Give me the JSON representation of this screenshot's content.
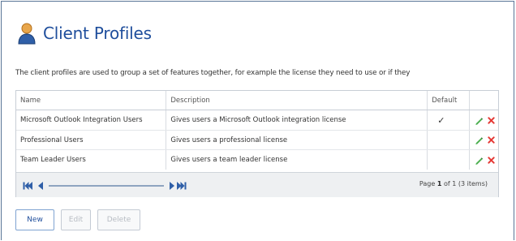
{
  "header": {
    "title": "Client Profiles",
    "icon": "person-icon"
  },
  "description": "The client profiles are used to group a set of features together, for example the license they need to use or if they",
  "grid": {
    "columns": {
      "name": "Name",
      "description": "Description",
      "default": "Default"
    },
    "rows": [
      {
        "name": "Microsoft Outlook Integration Users",
        "description": "Gives users a Microsoft Outlook integration license",
        "default": "✓"
      },
      {
        "name": "Professional Users",
        "description": "Gives users a professional license",
        "default": ""
      },
      {
        "name": "Team Leader Users",
        "description": "Gives users a team leader license",
        "default": ""
      }
    ],
    "row_actions": [
      "edit-icon",
      "delete-icon"
    ],
    "pager": {
      "text_prefix": "Page",
      "page": "1",
      "text_of": "of",
      "total_pages": "1",
      "item_count": "(3 items)"
    }
  },
  "buttons": {
    "new": "New",
    "edit": "Edit",
    "delete": "Delete"
  },
  "colors": {
    "title": "#1f4e9c",
    "frame": "#5a7596",
    "edit": "#4caf50",
    "delete": "#e53935"
  }
}
